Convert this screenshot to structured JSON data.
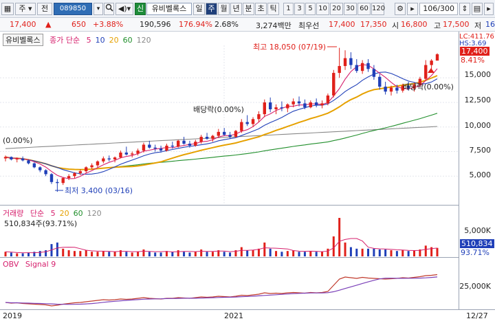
{
  "toolbar": {
    "item_type": "주",
    "market_button": "전",
    "code_value": "089850",
    "sound_icon": "speaker-icon",
    "badge_new": "신",
    "stock_name": "유비벨록스",
    "periods": [
      "일",
      "주",
      "월",
      "년",
      "분",
      "초",
      "틱"
    ],
    "active_period": "주",
    "intervals": [
      "1",
      "3",
      "5",
      "10",
      "20",
      "30",
      "60",
      "120"
    ],
    "count_display": "106/300"
  },
  "quote": {
    "price": "17,400",
    "change": "650",
    "change_pct": "+3.88%",
    "volume": "190,596",
    "volume_ratio": "176.94%",
    "turnover": "2.68%",
    "amount": "3,274백만",
    "quote_label": "최우선",
    "best_ask": "17,400",
    "best_bid": "17,350",
    "open_label": "시",
    "open": "16,800",
    "high_label": "고",
    "high": "17,500",
    "low_label": "저",
    "low": "16"
  },
  "price_pane": {
    "name_box": "유비벨록스",
    "ma_title": "종가 단순",
    "ma_periods": [
      "5",
      "10",
      "20",
      "60",
      "120"
    ],
    "ma_colors": [
      "#d6206d",
      "#1f3fb8",
      "#e6a100",
      "#1f8e2a",
      "#888888"
    ],
    "annot_high": "최고 18,050 (07/19)",
    "annot_low": "최저 3,400 (03/16)",
    "annot_div1": "배당락(0.00%)",
    "annot_div2": "배당락(0.00%)",
    "annot_left": "(0.00%)",
    "lc_label": "LC:411.76",
    "hs_label": "HS:3.69",
    "current_tag": "17,400",
    "pct_tag": "8.41%",
    "axis": [
      "15,000",
      "12,500",
      "10,000",
      "7,500",
      "5,000"
    ]
  },
  "vol_pane": {
    "title": "거래량",
    "ma_title": "단순",
    "ma_periods": [
      "5",
      "20",
      "60",
      "120"
    ],
    "value_text": "510,834주(93.71%)",
    "axis": [
      "5,000K"
    ],
    "current_tag": "510,834",
    "pct_tag": "93.71%"
  },
  "obv_pane": {
    "title": "OBV",
    "signal": "Signal 9",
    "axis": [
      "25,000K"
    ]
  },
  "time_axis": {
    "labels": [
      "2019",
      "2021",
      "12/27"
    ]
  },
  "chart_data": {
    "type": "candlestick",
    "ylim": [
      2500,
      19000
    ],
    "candles": [
      [
        6800,
        7100,
        6500,
        6950
      ],
      [
        6950,
        7000,
        6600,
        6700
      ],
      [
        6700,
        6900,
        6400,
        6800
      ],
      [
        6800,
        7000,
        6500,
        6600
      ],
      [
        6600,
        6700,
        6200,
        6300
      ],
      [
        6300,
        6400,
        5800,
        5900
      ],
      [
        5900,
        6000,
        5400,
        5600
      ],
      [
        5600,
        5700,
        5000,
        5200
      ],
      [
        5200,
        5300,
        4200,
        4400
      ],
      [
        4400,
        4700,
        3400,
        4300
      ],
      [
        4300,
        4900,
        4100,
        4800
      ],
      [
        4800,
        5200,
        4600,
        5000
      ],
      [
        5000,
        5400,
        4800,
        5300
      ],
      [
        5300,
        5700,
        5100,
        5500
      ],
      [
        5500,
        6000,
        5300,
        5900
      ],
      [
        5900,
        6300,
        5700,
        6100
      ],
      [
        6100,
        6600,
        5900,
        6500
      ],
      [
        6500,
        7000,
        6300,
        6800
      ],
      [
        6800,
        7100,
        6500,
        6700
      ],
      [
        6700,
        7000,
        6400,
        6900
      ],
      [
        6900,
        7600,
        6800,
        7400
      ],
      [
        7400,
        8000,
        7100,
        7200
      ],
      [
        7200,
        7500,
        6900,
        7300
      ],
      [
        7300,
        7800,
        7100,
        7600
      ],
      [
        7600,
        8400,
        7400,
        8200
      ],
      [
        8200,
        8600,
        7800,
        7900
      ],
      [
        7900,
        8200,
        7500,
        7800
      ],
      [
        7800,
        8100,
        7400,
        7600
      ],
      [
        7600,
        8300,
        7500,
        8100
      ],
      [
        8100,
        8500,
        7800,
        8000
      ],
      [
        8000,
        8700,
        7900,
        8600
      ],
      [
        8600,
        9000,
        8200,
        8300
      ],
      [
        8300,
        8600,
        7900,
        8100
      ],
      [
        8100,
        8700,
        8000,
        8500
      ],
      [
        8500,
        9200,
        8300,
        9000
      ],
      [
        9000,
        9400,
        8700,
        8800
      ],
      [
        8800,
        9200,
        8500,
        9100
      ],
      [
        9100,
        9800,
        8900,
        9500
      ],
      [
        9500,
        9900,
        9100,
        9200
      ],
      [
        9200,
        9500,
        8800,
        9000
      ],
      [
        9000,
        9700,
        8900,
        9600
      ],
      [
        9600,
        10800,
        9400,
        10500
      ],
      [
        10500,
        11200,
        10100,
        10300
      ],
      [
        10300,
        11000,
        10000,
        10800
      ],
      [
        10800,
        11600,
        10500,
        11300
      ],
      [
        11300,
        12800,
        11000,
        12500
      ],
      [
        12500,
        13000,
        11500,
        11800
      ],
      [
        11800,
        12300,
        11300,
        12000
      ],
      [
        12000,
        12600,
        11600,
        11900
      ],
      [
        11900,
        12400,
        11500,
        12300
      ],
      [
        12300,
        12900,
        12000,
        12600
      ],
      [
        12600,
        13100,
        12100,
        12400
      ],
      [
        12400,
        12800,
        11800,
        12000
      ],
      [
        12000,
        12700,
        11900,
        12500
      ],
      [
        12500,
        12900,
        12000,
        12200
      ],
      [
        12200,
        12700,
        11900,
        12400
      ],
      [
        12400,
        13400,
        12200,
        13200
      ],
      [
        13200,
        15800,
        13000,
        15500
      ],
      [
        15500,
        18050,
        15000,
        16200
      ],
      [
        16200,
        17800,
        15800,
        17000
      ],
      [
        17000,
        17600,
        15900,
        16300
      ],
      [
        16300,
        16900,
        15500,
        15700
      ],
      [
        15700,
        16800,
        15400,
        16500
      ],
      [
        16500,
        16900,
        15600,
        15900
      ],
      [
        15900,
        16300,
        14800,
        15100
      ],
      [
        15100,
        15400,
        13800,
        14100
      ],
      [
        14100,
        14600,
        13300,
        13600
      ],
      [
        13600,
        14200,
        13200,
        14000
      ],
      [
        14000,
        14300,
        13400,
        13700
      ],
      [
        13700,
        14400,
        13500,
        14200
      ],
      [
        14200,
        14600,
        13700,
        13900
      ],
      [
        13900,
        14500,
        13600,
        14300
      ],
      [
        14300,
        15100,
        14100,
        14900
      ],
      [
        14900,
        16800,
        14700,
        16300
      ],
      [
        16300,
        16900,
        15800,
        16750
      ],
      [
        16750,
        17500,
        16800,
        17400
      ]
    ],
    "volumes": [
      0.3,
      0.25,
      0.2,
      0.2,
      0.25,
      0.3,
      0.35,
      0.4,
      0.8,
      0.9,
      0.5,
      0.4,
      0.35,
      0.35,
      0.4,
      0.3,
      0.3,
      0.35,
      0.3,
      0.3,
      0.4,
      0.3,
      0.25,
      0.3,
      0.45,
      0.3,
      0.25,
      0.25,
      0.35,
      0.3,
      0.4,
      0.3,
      0.25,
      0.3,
      0.45,
      0.3,
      0.3,
      0.4,
      0.3,
      0.25,
      0.4,
      0.6,
      0.4,
      0.4,
      0.5,
      0.9,
      0.5,
      0.35,
      0.3,
      0.35,
      0.4,
      0.3,
      0.3,
      0.35,
      0.3,
      0.3,
      0.5,
      1.3,
      2.5,
      0.9,
      0.6,
      0.5,
      0.5,
      0.5,
      0.5,
      0.45,
      0.45,
      0.4,
      0.35,
      0.4,
      0.35,
      0.4,
      0.45,
      0.7,
      0.6,
      0.55
    ],
    "obv": [
      0.1,
      0.08,
      0.09,
      0.07,
      0.06,
      0.05,
      0.04,
      0.03,
      0.0,
      0.02,
      0.05,
      0.07,
      0.09,
      0.1,
      0.12,
      0.14,
      0.16,
      0.18,
      0.17,
      0.18,
      0.2,
      0.19,
      0.2,
      0.22,
      0.24,
      0.22,
      0.21,
      0.2,
      0.22,
      0.22,
      0.24,
      0.23,
      0.22,
      0.24,
      0.26,
      0.25,
      0.26,
      0.28,
      0.27,
      0.26,
      0.28,
      0.31,
      0.3,
      0.32,
      0.34,
      0.38,
      0.36,
      0.37,
      0.36,
      0.38,
      0.39,
      0.38,
      0.37,
      0.39,
      0.38,
      0.39,
      0.42,
      0.6,
      0.78,
      0.84,
      0.82,
      0.8,
      0.83,
      0.81,
      0.8,
      0.79,
      0.78,
      0.79,
      0.8,
      0.82,
      0.81,
      0.83,
      0.85,
      0.88,
      0.89,
      0.91
    ]
  }
}
